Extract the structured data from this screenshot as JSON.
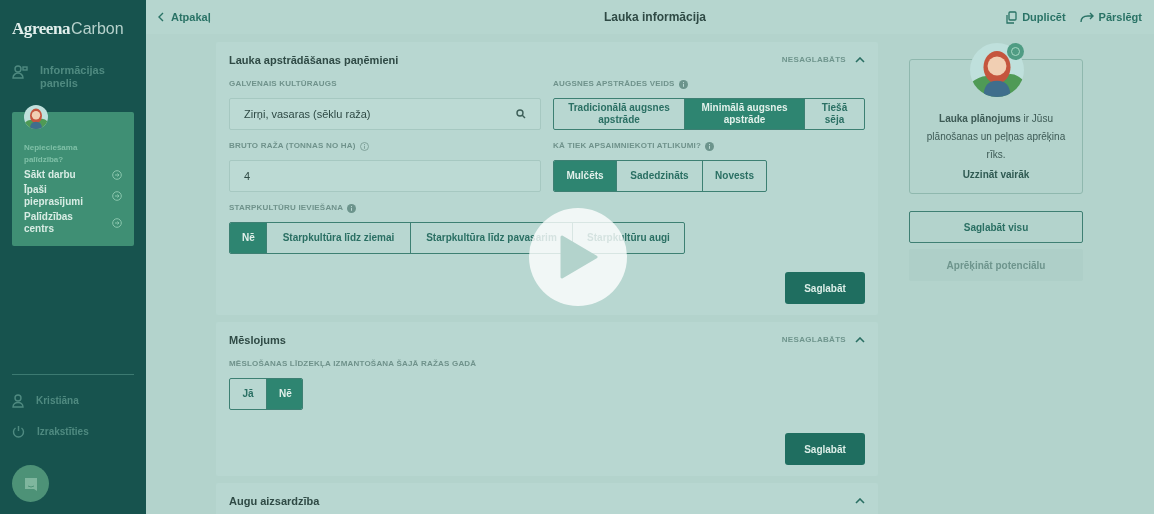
{
  "sidebar": {
    "logo": {
      "brand": "Agreena",
      "product": "Carbon"
    },
    "nav": [
      {
        "label": "Informācijas panelis"
      }
    ],
    "help": {
      "title": "Nepieciešama palīdzība?",
      "links": [
        {
          "label": "Sākt darbu"
        },
        {
          "label": "Īpaši pieprasījumi"
        },
        {
          "label": "Palīdzības centrs"
        }
      ]
    },
    "footer": [
      {
        "label": "Kristiāna"
      },
      {
        "label": "Izrakstīties"
      }
    ]
  },
  "topbar": {
    "back": "Atpakaļ",
    "title": "Lauka informācija",
    "actions": [
      {
        "label": "Duplicēt"
      },
      {
        "label": "Pārslēgt"
      }
    ]
  },
  "sections": [
    {
      "title": "Lauka apstrādāšanas paņēmieni",
      "status": "NESAGLABĀTS",
      "expanded": true,
      "save": "Saglabāt",
      "rows": [
        [
          {
            "kind": "search",
            "label": "GALVENAIS KULTŪRAUGS",
            "value": "Zirņi, vasaras (sēklu raža)"
          },
          {
            "kind": "segmented",
            "label": "AUGSNES APSTRĀDES VEIDS",
            "info": true,
            "options": [
              {
                "label": "Tradicionālā augsnes apstrāde",
                "selected": false
              },
              {
                "label": "Minimālā augsnes apstrāde",
                "selected": true
              },
              {
                "label": "Tiešā sēja",
                "selected": false
              }
            ]
          }
        ],
        [
          {
            "kind": "text",
            "label": "BRUTO RAŽA (TONNAS NO HA)",
            "info": true,
            "value": "4"
          },
          {
            "kind": "segmented",
            "label": "KĀ TIEK APSAIMNIEKOTI ATLIKUMI?",
            "info": true,
            "options": [
              {
                "label": "Mulčēts",
                "selected": true
              },
              {
                "label": "Sadedzināts",
                "selected": false
              },
              {
                "label": "Novests",
                "selected": false
              }
            ]
          }
        ],
        [
          {
            "kind": "segmented",
            "label": "STARPKULTŪRU IEVIEŠANA",
            "info": true,
            "options": [
              {
                "label": "Nē",
                "selected": true
              },
              {
                "label": "Starpkultūra līdz ziemai",
                "selected": false
              },
              {
                "label": "Starpkultūra līdz pavasarim",
                "selected": false
              },
              {
                "label": "Starpkultūru augi",
                "selected": false
              }
            ]
          }
        ]
      ]
    },
    {
      "title": "Mēslojums",
      "status": "NESAGLABĀTS",
      "expanded": true,
      "save": "Saglabāt",
      "rows": [
        [
          {
            "kind": "segmented",
            "label": "MĒSLOŠANAS LĪDZEKĻA IZMANTOŠANA ŠAJĀ RAŽAS GADĀ",
            "options": [
              {
                "label": "Jā",
                "selected": false
              },
              {
                "label": "Nē",
                "selected": true
              }
            ]
          }
        ]
      ]
    },
    {
      "title": "Augu aizsardzība",
      "expanded": true
    }
  ],
  "aside": {
    "info": "**Lauka plānojums** ir Jūsu plānošanas un peļņas aprēķina rīks.",
    "link": "Uzzināt vairāk",
    "buttons": [
      {
        "label": "Saglabāt visu",
        "disabled": false
      },
      {
        "label": "Aprēķināt potenciālu",
        "disabled": true
      }
    ]
  }
}
